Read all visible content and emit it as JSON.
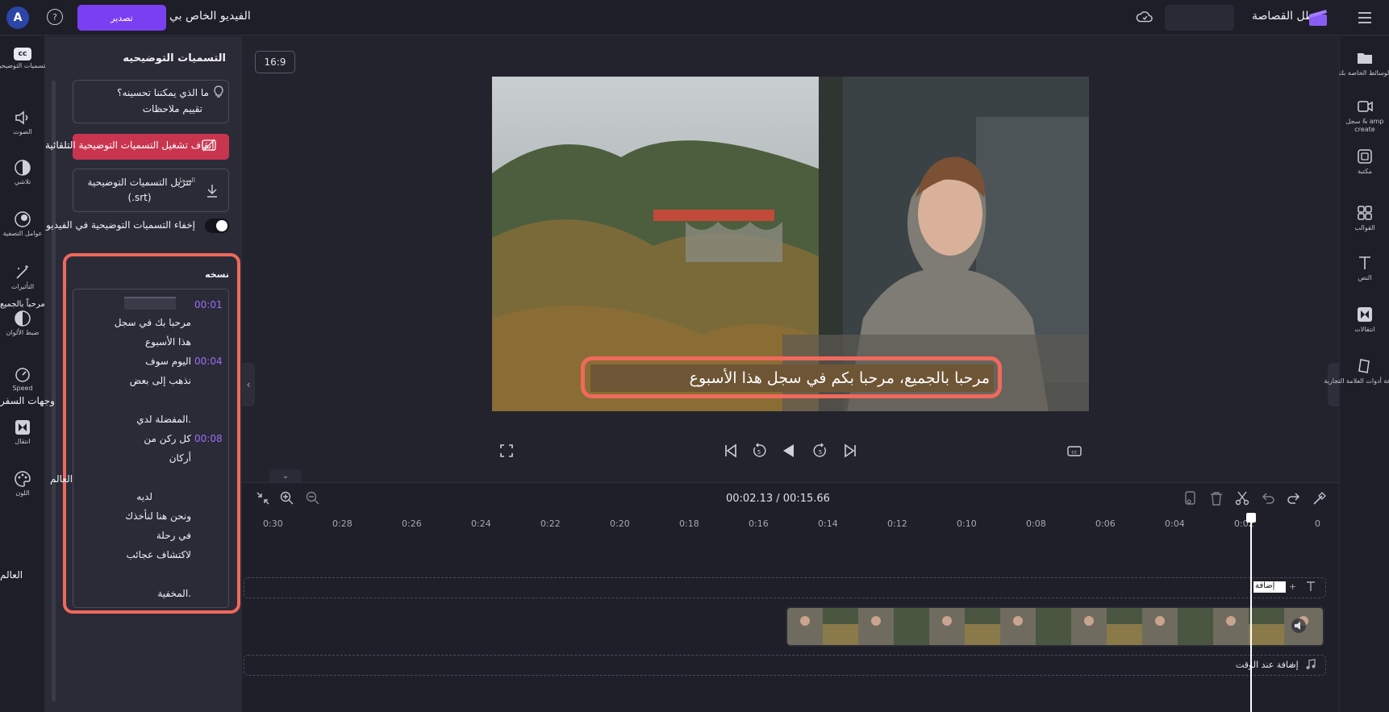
{
  "topbar": {
    "avatar_letter": "A",
    "help_label": "?",
    "export_label": "تصدير",
    "video_title": "الفيديو الخاص بي",
    "app_title": "بطل القصاصة"
  },
  "left_rail": {
    "items": [
      {
        "label": "التسميات التوضيحية",
        "icon": "captions-icon"
      },
      {
        "label": "الصوت",
        "icon": "audio-icon"
      },
      {
        "label": "تلاشي",
        "icon": "fade-icon"
      },
      {
        "label": "عوامل التصفية",
        "icon": "filters-icon"
      },
      {
        "label": "التأثيرات",
        "icon": "effects-icon"
      },
      {
        "label": "ضبط الألوان",
        "icon": "color-adjust-icon"
      },
      {
        "label": "Speed",
        "icon": "speed-icon"
      },
      {
        "label": "انتقال",
        "icon": "transition-icon"
      },
      {
        "label": "اللون",
        "icon": "palette-icon"
      }
    ]
  },
  "panel": {
    "title": "التسميات التوضيحيه",
    "feedback_question": "ما الذي يمكننا تحسينه؟",
    "feedback_rate": "تقييم ملاحظات",
    "stop_auto_captions": "إيقاف تشغيل التسميات التوضيحية التلقائية",
    "download_line1": "تنزيل التسميات التوضيحية",
    "download_line2": "(.srt)",
    "download_small": "السجل",
    "hide_captions": "إخفاء التسميات التوضيحية في الفيديو",
    "hide_captions_on": true,
    "transcript_heading": "نسخه",
    "overflow_words": [
      "مرحباً بالجميع",
      "وجهات السفر",
      "العالم",
      "العالم"
    ],
    "transcript": [
      {
        "time": "00:01",
        "lines": [
          "مرحبا بك في سجل",
          "هذا الأسبوع"
        ]
      },
      {
        "time": "00:04",
        "lines": [
          "اليوم سوف",
          "نذهب إلى بعض",
          "",
          "المفضلة لدي."
        ]
      },
      {
        "time": "00:08",
        "lines": [
          "كل ركن من",
          "أركان"
        ]
      },
      {
        "time": "",
        "lines": [
          "لديه",
          "ونحن هنا لنأخذك",
          "في رحلة",
          "لاكتشاف عجائب",
          "",
          "المخفية."
        ]
      }
    ]
  },
  "preview": {
    "aspect_ratio": "16:9",
    "caption": "مرحبا بالجميع، مرحبا بكم في سجل هذا الأسبوع"
  },
  "timeline": {
    "timecode": "00:02.13 / 00:15.66",
    "ruler": [
      "0",
      "0:02",
      "0:04",
      "0:06",
      "0:08",
      "0:10",
      "0:12",
      "0:14",
      "0:16",
      "0:18",
      "0:20",
      "0:22",
      "0:24",
      "0:26",
      "0:28",
      "0:30"
    ],
    "text_track_label": "إضافة",
    "text_track_prefix": "+",
    "audio_track_label": "إضافة عند الوقت",
    "audio_track_prefix": "+"
  },
  "right_rail": {
    "items": [
      {
        "label": "الوسائط الخاصة بك",
        "icon": "folder-icon"
      },
      {
        "label": "سجل & amp\ncreate",
        "icon": "record-icon"
      },
      {
        "label": "مكتبة",
        "icon": "library-icon"
      },
      {
        "label": "القوالب",
        "icon": "templates-icon"
      },
      {
        "label": "النص",
        "icon": "text-icon"
      },
      {
        "label": "انتقالات",
        "icon": "transitions-icon"
      },
      {
        "label": "مجموعة أدوات العلامة التجارية",
        "icon": "brand-kit-icon"
      }
    ]
  }
}
